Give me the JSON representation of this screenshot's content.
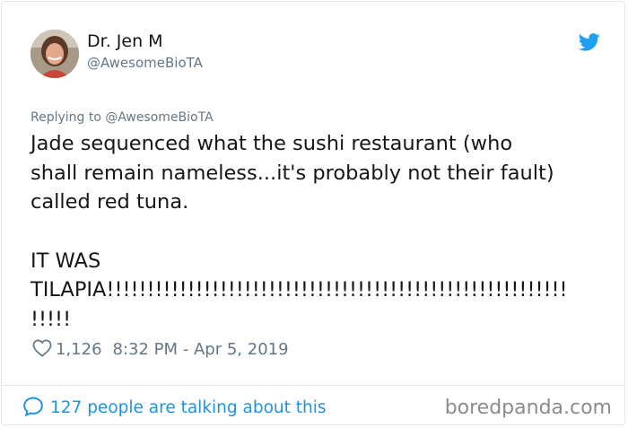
{
  "author": {
    "display_name": "Dr. Jen M",
    "handle": "@AwesomeBioTA"
  },
  "reply": {
    "text": "Replying to @AwesomeBioTA"
  },
  "tweet": {
    "lines": [
      "Jade sequenced what the sushi restaurant (who",
      "shall remain nameless...it's probably not their fault)",
      "called red tuna.",
      "",
      "IT WAS",
      "TILAPIA!!!!!!!!!!!!!!!!!!!!!!!!!!!!!!!!!!!!!!!!!!!!!!!!!!!!!!!!!",
      "!!!!!"
    ]
  },
  "meta": {
    "likes": "1,126",
    "timestamp": "8:32 PM - Apr 5, 2019"
  },
  "footer": {
    "talking": "127 people are talking about this",
    "watermark": "boredpanda.com"
  },
  "icons": {
    "bird": "twitter-bird-icon",
    "heart": "heart-icon",
    "speech_bubble": "speech-bubble-icon"
  },
  "colors": {
    "twitter_blue": "#1da1f2",
    "link_blue": "#1b95e0",
    "muted_gray": "#657786",
    "text": "#14171a"
  }
}
